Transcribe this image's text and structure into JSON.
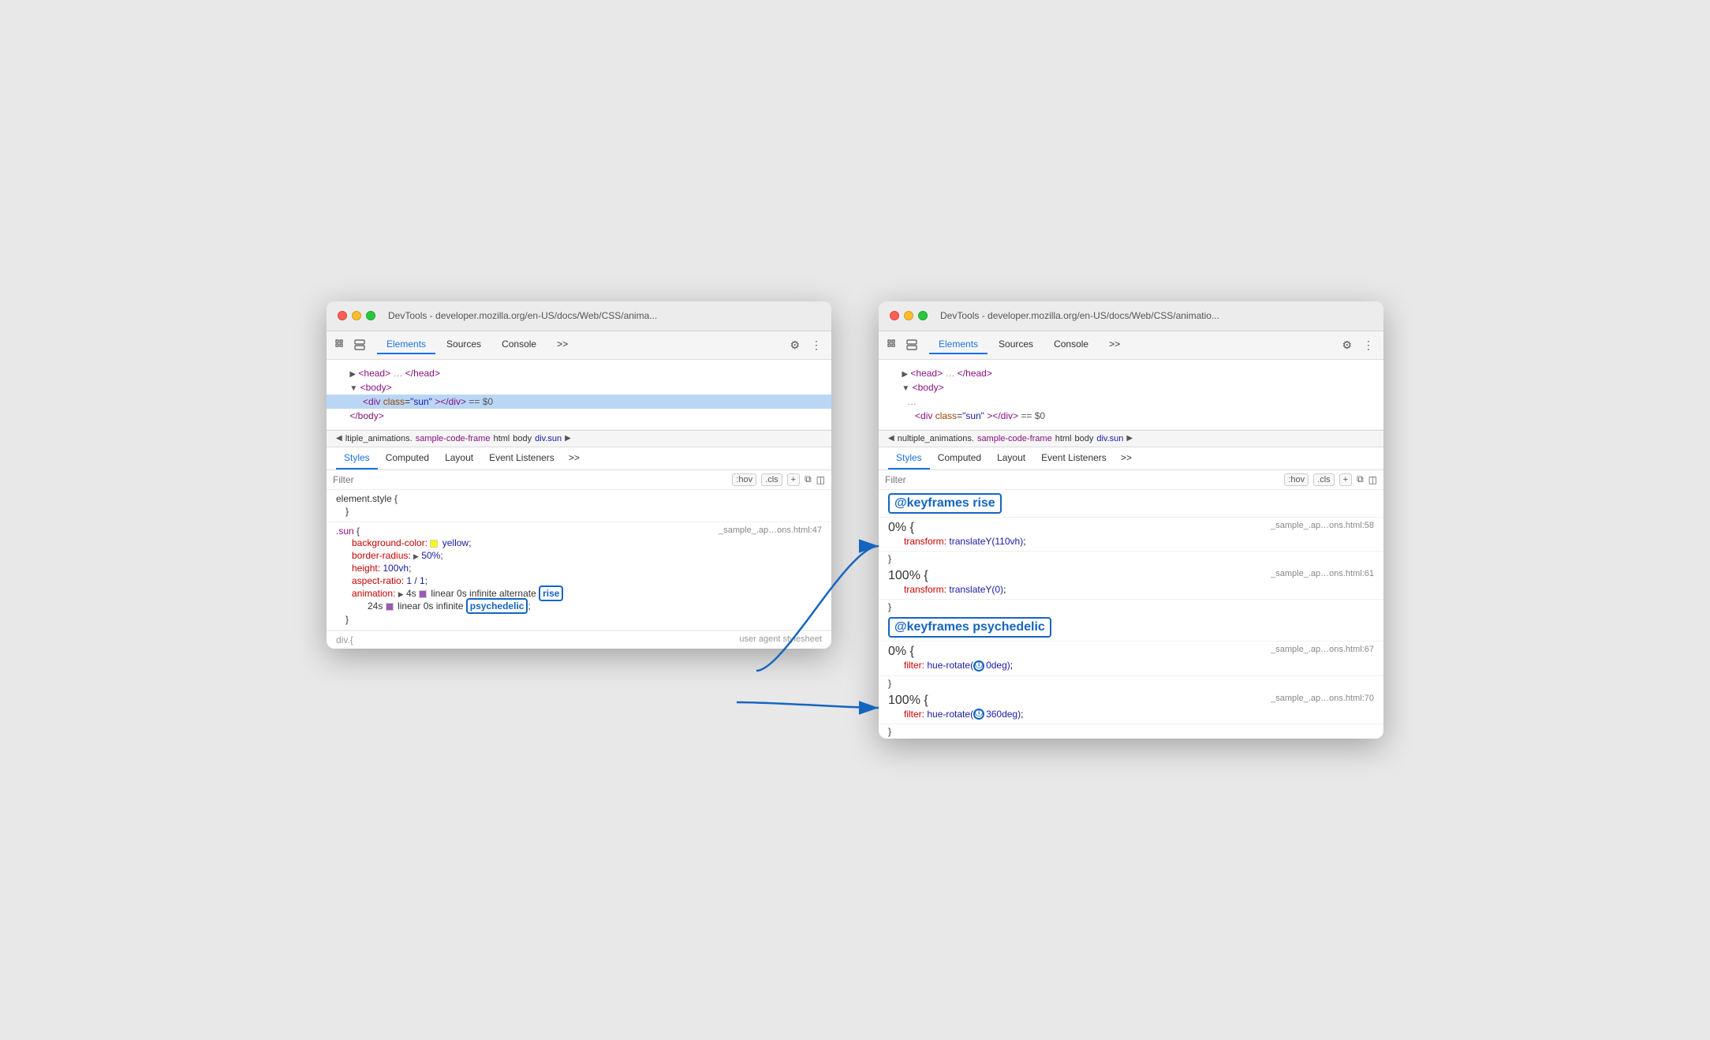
{
  "scene": {
    "background": "#e8e8e8"
  },
  "left_window": {
    "titlebar": {
      "title": "DevTools - developer.mozilla.org/en-US/docs/Web/CSS/anima..."
    },
    "toolbar": {
      "icons": [
        "cursor-icon",
        "layers-icon"
      ],
      "tabs": [
        "Elements",
        "Sources",
        "Console"
      ],
      "active_tab": "Elements",
      "more_label": ">>",
      "gear_label": "⚙",
      "more_dots": "⋮"
    },
    "html_tree": {
      "lines": [
        {
          "indent": 0,
          "content": "▶ <head> … </head>",
          "selected": false
        },
        {
          "indent": 0,
          "content": "▼ <body>",
          "selected": false
        },
        {
          "indent": 1,
          "content": "<div class=\"sun\"></div>  == $0",
          "selected": true
        },
        {
          "indent": 0,
          "content": "</body>",
          "selected": false
        }
      ]
    },
    "breadcrumb": {
      "arrow": "◀",
      "file": "ltiple_animations.",
      "file_link": "sample-code-frame",
      "tags": [
        "html",
        "body"
      ],
      "class_tag": "div.sun",
      "right_arrow": "▶"
    },
    "styles_tabs": [
      "Styles",
      "Computed",
      "Layout",
      "Event Listeners",
      ">>"
    ],
    "active_styles_tab": "Styles",
    "filter": {
      "placeholder": "Filter",
      "hov_btn": ":hov",
      "cls_btn": ".cls",
      "plus_btn": "+",
      "copy_icon": "⧉",
      "sidebar_icon": "◫"
    },
    "css_rules": [
      {
        "type": "rule",
        "selector": "element.style {",
        "close": "}",
        "properties": []
      },
      {
        "type": "rule",
        "selector": ".sun {",
        "source": "_sample_.ap…ons.html:47",
        "close": "}",
        "properties": [
          {
            "name": "background-color:",
            "value": "yellow;",
            "has_swatch": true,
            "swatch_color": "yellow"
          },
          {
            "name": "border-radius:",
            "value": "▶ 50%;",
            "has_swatch": false
          },
          {
            "name": "height:",
            "value": "100vh;",
            "has_swatch": false
          },
          {
            "name": "aspect-ratio:",
            "value": "1 / 1;",
            "has_swatch": false
          },
          {
            "name": "animation:",
            "value": "▶ 4s ",
            "swatch_color": "#9b59b6",
            "has_animation": true,
            "anim_rest": "linear 0s infinite alternate ",
            "rise_word": "rise",
            "second_line": "24s  linear 0s infinite ",
            "psychedelic_word": "psychedelic;"
          }
        ]
      }
    ],
    "bottom_fade": "div.{"
  },
  "right_window": {
    "titlebar": {
      "title": "DevTools - developer.mozilla.org/en-US/docs/Web/CSS/animatio..."
    },
    "toolbar": {
      "icons": [
        "cursor-icon",
        "layers-icon"
      ],
      "tabs": [
        "Elements",
        "Sources",
        "Console"
      ],
      "active_tab": "Elements",
      "more_label": ">>",
      "gear_label": "⚙",
      "more_dots": "⋮"
    },
    "html_tree": {
      "lines": [
        {
          "indent": 0,
          "content": "▶ <head> … </head>",
          "selected": false
        },
        {
          "indent": 0,
          "content": "▼ <body>",
          "selected": false
        },
        {
          "indent": 1,
          "content": "...",
          "selected": false
        },
        {
          "indent": 1,
          "content": "<div class=\"sun\"></div>  == $0",
          "selected": false
        }
      ]
    },
    "breadcrumb": {
      "arrow": "◀",
      "file": "nultiple_animations.",
      "file_link": "sample-code-frame",
      "tags": [
        "html",
        "body"
      ],
      "class_tag": "div.sun",
      "right_arrow": "▶"
    },
    "styles_tabs": [
      "Styles",
      "Computed",
      "Layout",
      "Event Listeners",
      ">>"
    ],
    "active_styles_tab": "Styles",
    "filter": {
      "placeholder": "Filter",
      "hov_btn": ":hov",
      "cls_btn": ".cls",
      "plus_btn": "+",
      "copy_icon": "⧉",
      "sidebar_icon": "◫"
    },
    "keyframes": [
      {
        "name": "@keyframes rise",
        "percents": [
          {
            "label": "0% {",
            "source": "_sample_.ap…ons.html:58",
            "props": [
              {
                "name": "transform:",
                "value": "translateY(110vh);"
              }
            ],
            "close": "}"
          },
          {
            "label": "100% {",
            "source": "_sample_.ap…ons.html:61",
            "props": [
              {
                "name": "transform:",
                "value": "translateY(0);"
              }
            ],
            "close": "}"
          }
        ]
      },
      {
        "name": "@keyframes psychedelic",
        "percents": [
          {
            "label": "0% {",
            "source": "_sample_.ap…ons.html:67",
            "props": [
              {
                "name": "filter:",
                "value": "hue-rotate(",
                "info": true,
                "value2": "0deg);"
              }
            ],
            "close": "}"
          },
          {
            "label": "100% {",
            "source": "_sample_.ap…ons.html:70",
            "props": [
              {
                "name": "filter:",
                "value": "hue-rotate(",
                "info": true,
                "value2": "360deg);"
              }
            ],
            "close": "}"
          }
        ]
      }
    ]
  }
}
